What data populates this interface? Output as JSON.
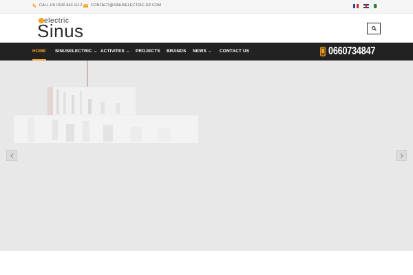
{
  "topbar": {
    "phone_text": "CALL US 0100 843 1112",
    "email_text": "CONTACT@SINUSELECTRIC-DZ.COM",
    "languages": [
      "French",
      "English",
      "Arabic"
    ]
  },
  "header": {
    "logo_small": "electric",
    "logo_big": "Sinus"
  },
  "nav": {
    "items": [
      {
        "label": "HOME",
        "active": true,
        "has_dropdown": false
      },
      {
        "label": "SINUSELECTRIC",
        "active": false,
        "has_dropdown": true
      },
      {
        "label": "ACTIVITES",
        "active": false,
        "has_dropdown": true
      },
      {
        "label": "PROJECTS",
        "active": false,
        "has_dropdown": false
      },
      {
        "label": "BRANDS",
        "active": false,
        "has_dropdown": false
      },
      {
        "label": "NEWS",
        "active": false,
        "has_dropdown": true
      },
      {
        "label": "CONTACT US",
        "active": false,
        "has_dropdown": false
      }
    ],
    "phone_number": "0660734847"
  },
  "icons": {
    "phone": "phone-icon",
    "email": "envelope-icon",
    "search": "search-icon",
    "mobile": "mobile-phone-icon",
    "prev": "chevron-left-icon",
    "next": "chevron-right-icon"
  },
  "colors": {
    "accent": "#f2a01d",
    "nav_bg": "#222222",
    "slider_bg": "#e8e8e8"
  }
}
